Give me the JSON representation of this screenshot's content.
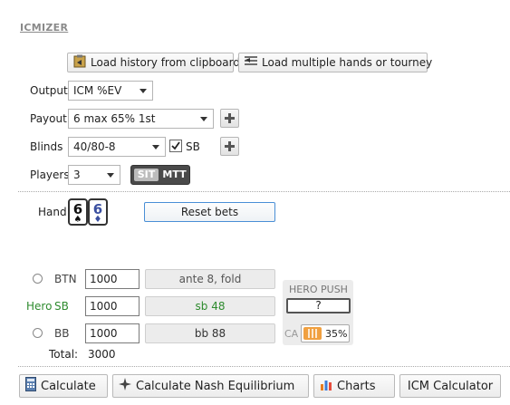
{
  "app": {
    "title": "ICMIZER"
  },
  "toolbar": {
    "load_clipboard": "Load history from clipboard",
    "load_multiple": "Load multiple hands or tourney"
  },
  "form": {
    "output_label": "Output",
    "output_value": "ICM %EV",
    "payout_label": "Payout",
    "payout_value": "6 max 65% 1st",
    "blinds_label": "Blinds",
    "blinds_value": "40/80-8",
    "sb_label": "SB",
    "sb_checked": true,
    "players_label": "Players",
    "players_value": "3",
    "mode_sit": "SIT",
    "mode_mtt": "MTT"
  },
  "hand": {
    "label": "Hand",
    "cards": [
      {
        "rank": "6",
        "suit": "♠",
        "color": "#111111"
      },
      {
        "rank": "6",
        "suit": "♦",
        "color": "#3a4fa0"
      }
    ],
    "reset_label": "Reset bets"
  },
  "players": [
    {
      "position": "BTN",
      "stack": "1000",
      "action": "ante 8, fold",
      "is_hero": false
    },
    {
      "prefix": "Hero",
      "position": "SB",
      "stack": "1000",
      "action": "sb 48",
      "is_hero": true
    },
    {
      "position": "BB",
      "stack": "1000",
      "action": "bb 88",
      "is_hero": false
    }
  ],
  "total": {
    "label": "Total:",
    "value": "3000"
  },
  "hero_panel": {
    "title": "HERO PUSH",
    "result": "?",
    "ca_label": "CA",
    "ca_percent": "35%"
  },
  "bottom_bar": {
    "calculate": "Calculate",
    "nash": "Calculate Nash Equilibrium",
    "charts": "Charts",
    "icm_calculator": "ICM Calculator"
  },
  "colors": {
    "hero_green": "#2e8b2e",
    "ca_orange": "#f0a040",
    "action_hero_text": "#2e8b2e"
  }
}
